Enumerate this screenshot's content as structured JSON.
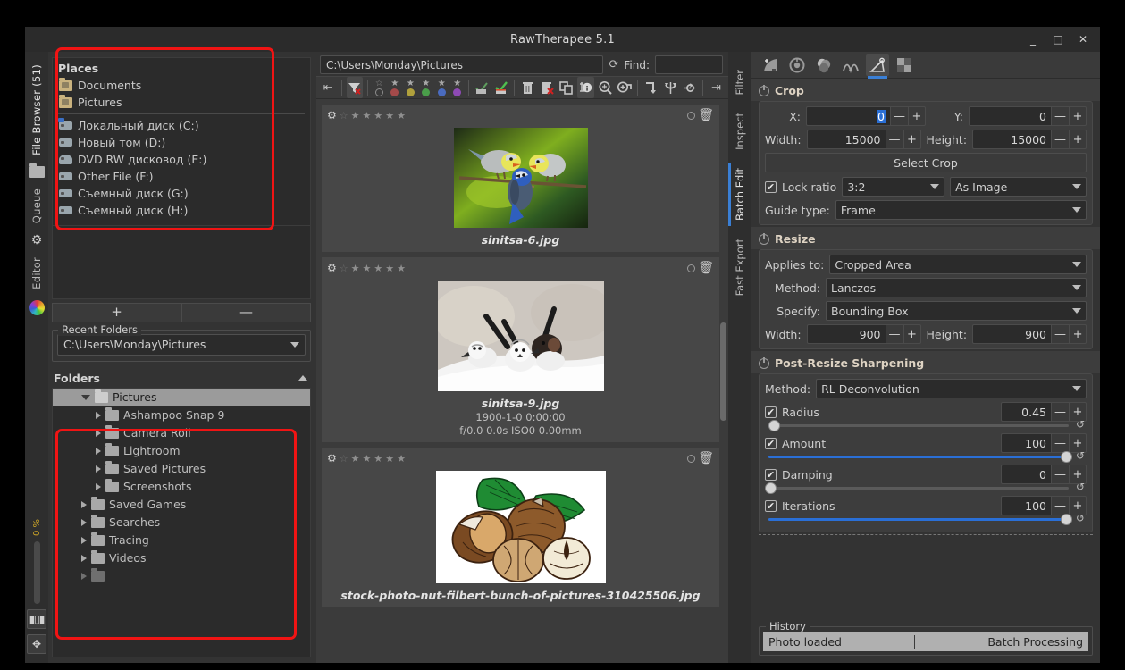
{
  "window": {
    "title": "RawTherapee 5.1",
    "minimize": "_",
    "maximize": "□",
    "close": "✕"
  },
  "left_tabs": {
    "file_browser": "File Browser (51)",
    "queue": "Queue",
    "editor": "Editor",
    "progress": "0 %"
  },
  "places": {
    "header": "Places",
    "items": [
      {
        "label": "Documents",
        "icon": "folder-pictures-icon"
      },
      {
        "label": "Pictures",
        "icon": "folder-pictures-icon"
      },
      {
        "label": "Локальный диск (C:)",
        "icon": "drive-system-icon"
      },
      {
        "label": "Новый том (D:)",
        "icon": "drive-icon"
      },
      {
        "label": "DVD RW дисковод (E:)",
        "icon": "dvd-drive-icon"
      },
      {
        "label": "Other File (F:)",
        "icon": "drive-icon"
      },
      {
        "label": "Съемный диск (G:)",
        "icon": "removable-drive-icon"
      },
      {
        "label": "Съемный диск (H:)",
        "icon": "removable-drive-icon"
      }
    ],
    "add_label": "+",
    "remove_label": "—"
  },
  "recent_folders": {
    "legend": "Recent Folders",
    "value": "C:\\Users\\Monday\\Pictures"
  },
  "folders": {
    "header": "Folders",
    "tree": [
      {
        "label": "Pictures",
        "indent": 1,
        "state": "open",
        "selected": true
      },
      {
        "label": "Ashampoo Snap 9",
        "indent": 2,
        "state": "collapsed",
        "selected": false
      },
      {
        "label": "Camera Roll",
        "indent": 2,
        "state": "collapsed",
        "selected": false
      },
      {
        "label": "Lightroom",
        "indent": 2,
        "state": "collapsed",
        "selected": false
      },
      {
        "label": "Saved Pictures",
        "indent": 2,
        "state": "collapsed",
        "selected": false
      },
      {
        "label": "Screenshots",
        "indent": 2,
        "state": "collapsed",
        "selected": false
      },
      {
        "label": "Saved Games",
        "indent": 1,
        "state": "collapsed",
        "selected": false
      },
      {
        "label": "Searches",
        "indent": 1,
        "state": "collapsed",
        "selected": false
      },
      {
        "label": "Tracing",
        "indent": 1,
        "state": "collapsed",
        "selected": false
      },
      {
        "label": "Videos",
        "indent": 1,
        "state": "collapsed",
        "selected": false
      }
    ]
  },
  "browser": {
    "path": "C:\\Users\\Monday\\Pictures",
    "find_label": "Find:",
    "find_value": "",
    "thumbnails": [
      {
        "name": "sinitsa-6.jpg",
        "date": "",
        "exif": "",
        "image": "blue-tits-on-branch"
      },
      {
        "name": "sinitsa-9.jpg",
        "date": "1900-1-0 0:00:00",
        "exif": "f/0.0 0.0s ISO0 0.00mm",
        "image": "long-tailed-tits-in-snow"
      },
      {
        "name": "stock-photo-nut-filbert-bunch-of-pictures-310425506.jpg",
        "date": "",
        "exif": "",
        "image": "hazelnuts-illustration"
      }
    ]
  },
  "right_tabs": {
    "filter": "Filter",
    "inspect": "Inspect",
    "batch_edit": "Batch Edit",
    "fast_export": "Fast Export"
  },
  "crop": {
    "title": "Crop",
    "x_label": "X:",
    "x_value": "0",
    "y_label": "Y:",
    "y_value": "0",
    "width_label": "Width:",
    "width_value": "15000",
    "height_label": "Height:",
    "height_value": "15000",
    "select_crop": "Select Crop",
    "lock_ratio_label": "Lock ratio",
    "ratio_value": "3:2",
    "orientation_value": "As Image",
    "guide_label": "Guide type:",
    "guide_value": "Frame",
    "minus": "—",
    "plus": "+"
  },
  "resize": {
    "title": "Resize",
    "applies_label": "Applies to:",
    "applies_value": "Cropped Area",
    "method_label": "Method:",
    "method_value": "Lanczos",
    "specify_label": "Specify:",
    "specify_value": "Bounding Box",
    "width_label": "Width:",
    "width_value": "900",
    "height_label": "Height:",
    "height_value": "900"
  },
  "sharpening": {
    "title": "Post-Resize Sharpening",
    "method_label": "Method:",
    "method_value": "RL Deconvolution",
    "sliders": [
      {
        "label": "Radius",
        "value": "0.45",
        "pct": 3
      },
      {
        "label": "Amount",
        "value": "100",
        "pct": 100
      },
      {
        "label": "Damping",
        "value": "0",
        "pct": 0
      },
      {
        "label": "Iterations",
        "value": "100",
        "pct": 100
      }
    ]
  },
  "history": {
    "legend": "History",
    "col1": "Photo loaded",
    "col2": "Batch Processing"
  },
  "colors": {
    "accent_blue": "#2a6fd6",
    "annotation_red": "#f01414",
    "panel_bg": "#333333",
    "field_bg": "#2b2b2b"
  }
}
